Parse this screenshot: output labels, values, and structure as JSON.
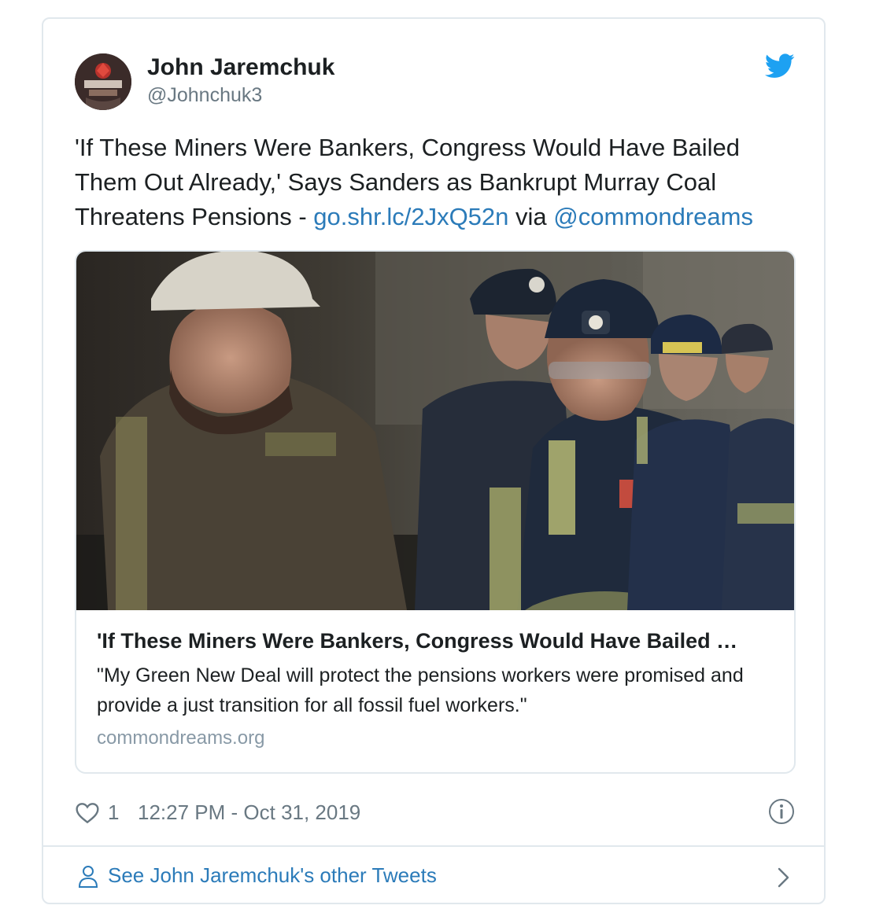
{
  "author": {
    "name": "John Jaremchuk",
    "handle": "@Johnchuk3"
  },
  "tweet": {
    "text": "'If These Miners Were Bankers, Congress Would Have Bailed Them Out Already,' Says Sanders as Bankrupt Murray Coal Threatens Pensions - ",
    "link": "go.shr.lc/2JxQ52n",
    "via": " via ",
    "mention": "@commondreams"
  },
  "card": {
    "title": "'If These Miners Were Bankers, Congress Would Have Bailed …",
    "description": "\"My Green New Deal will protect the pensions workers were promised and provide a just transition for all fossil fuel workers.\"",
    "domain": "commondreams.org"
  },
  "meta": {
    "likes": "1",
    "timestamp": "12:27 PM - Oct 31, 2019"
  },
  "footer": {
    "see_more": "See John Jaremchuk's other Tweets"
  },
  "colors": {
    "link": "#2b7bb9",
    "twitter_blue": "#1da1f2",
    "muted": "#697882",
    "border": "#e1e8ed"
  },
  "icons": [
    "avatar",
    "twitter-bird-icon",
    "heart-icon",
    "info-icon",
    "person-icon",
    "chevron-right-icon"
  ]
}
